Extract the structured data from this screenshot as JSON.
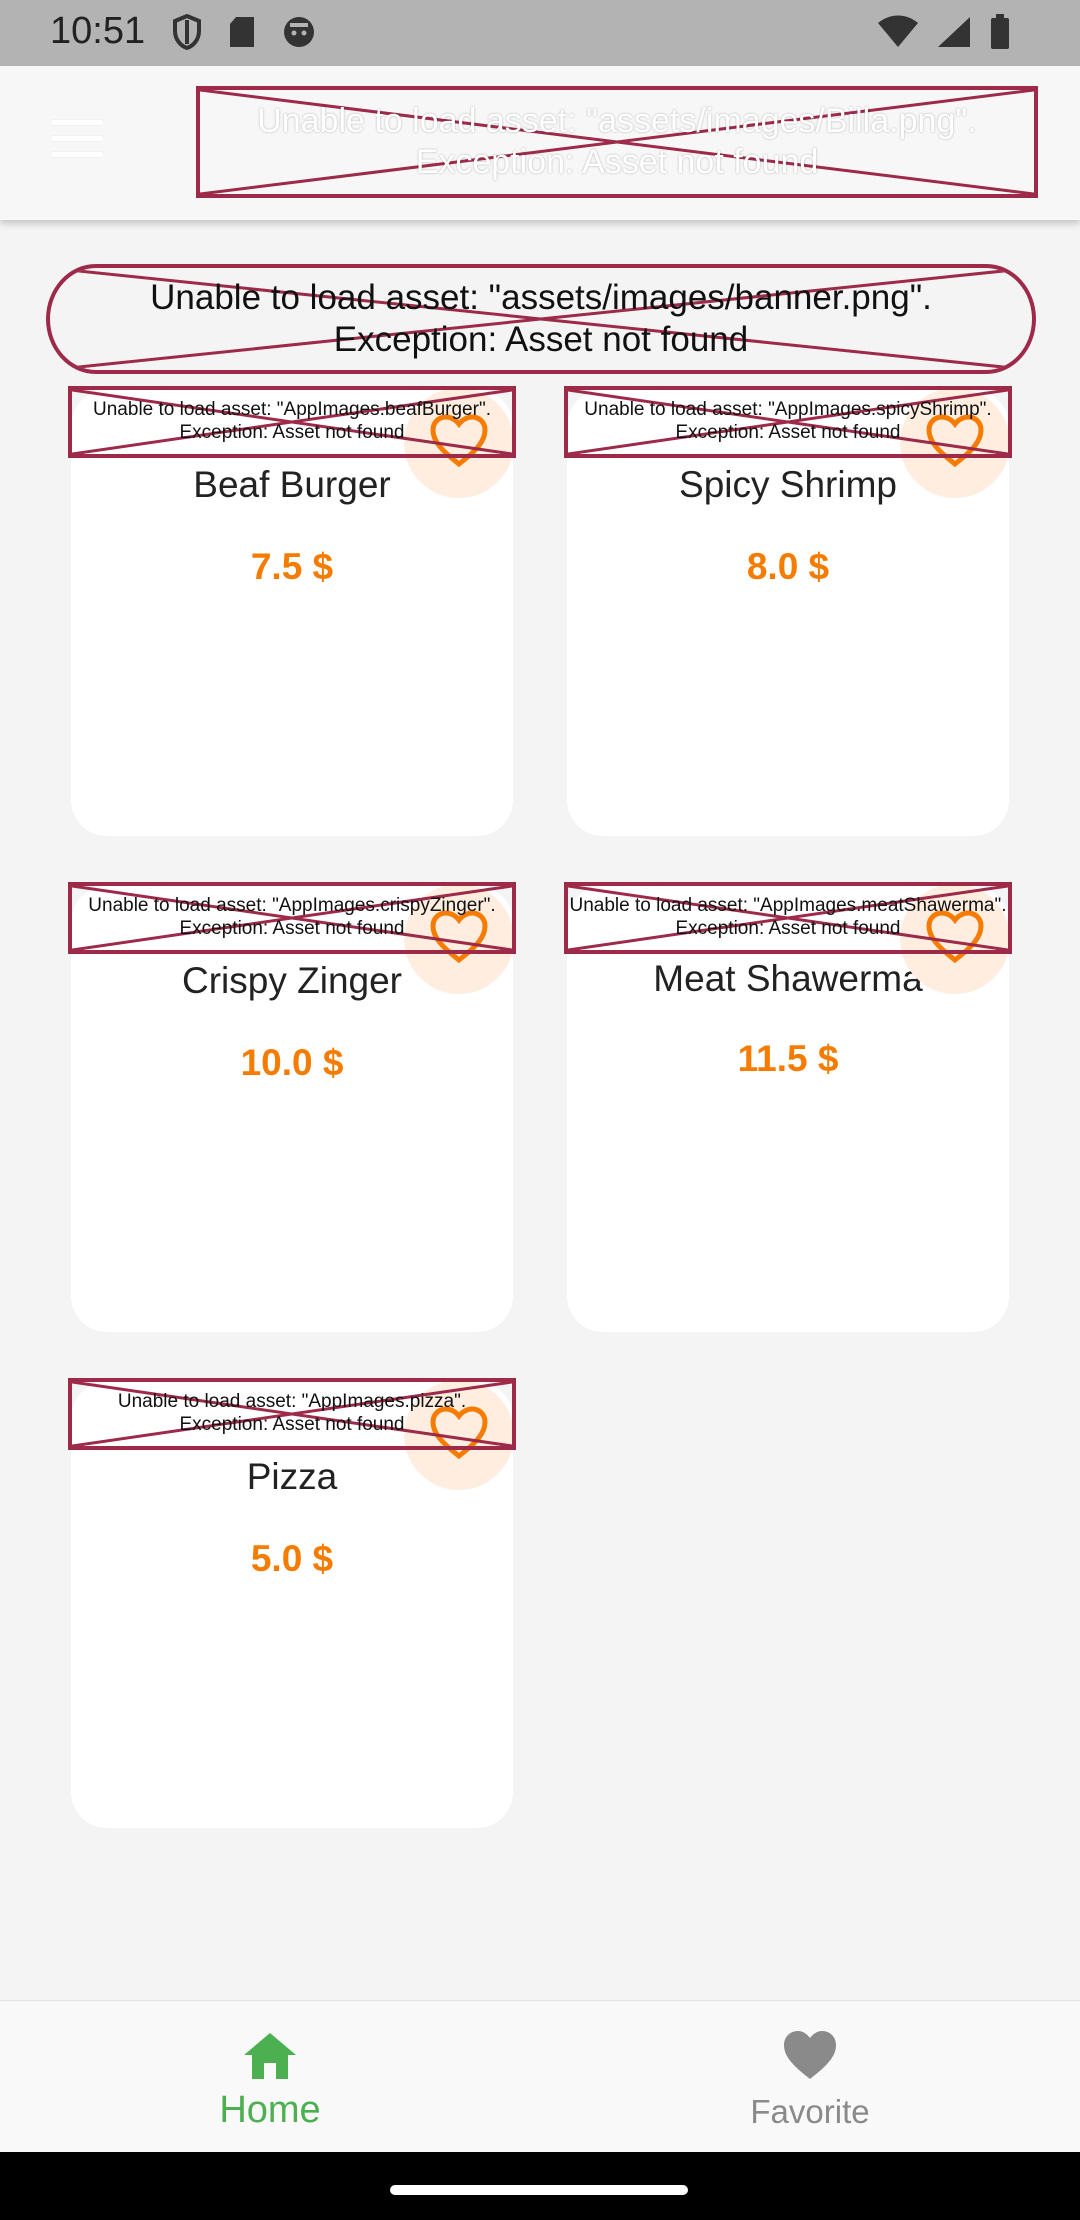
{
  "status_bar": {
    "time": "10:51",
    "left_icons": [
      "shield-icon",
      "sd-card-icon",
      "android-icon"
    ],
    "right_icons": [
      "wifi-icon",
      "signal-icon",
      "battery-icon"
    ]
  },
  "app_bar": {
    "menu_icon": "hamburger-menu-icon",
    "logo_error": "Unable to load asset: \"assets/images/Billa.png\".\nException: Asset not found"
  },
  "banner": {
    "error": "Unable to load asset: \"assets/images/banner.png\".\nException: Asset not found"
  },
  "products": [
    {
      "name": "Beaf Burger",
      "price": "7.5 $",
      "image_error": "Unable to load asset: \"AppImages.beafBurger\".\nException: Asset not found"
    },
    {
      "name": "Spicy Shrimp",
      "price": "8.0 $",
      "image_error": "Unable to load asset: \"AppImages.spicyShrimp\".\nException: Asset not found"
    },
    {
      "name": "Crispy Zinger",
      "price": "10.0 $",
      "image_error": "Unable to load asset: \"AppImages.crispyZinger\".\nException: Asset not found"
    },
    {
      "name": "Meat Shawerma",
      "price": "11.5 $",
      "image_error": "Unable to load asset: \"AppImages.meatShawerma\".\nException: Asset not found"
    },
    {
      "name": "Pizza",
      "price": "5.0 $",
      "image_error": "Unable to load asset: \"AppImages.pizza\".\nException: Asset not found"
    }
  ],
  "bottom_nav": {
    "home_label": "Home",
    "favorite_label": "Favorite",
    "active_color": "#4caf50",
    "inactive_color": "#8a8a8a"
  },
  "colors": {
    "price": "#f57c00",
    "error_border": "#9e2a4a",
    "favorite_icon": "#f57c00"
  }
}
